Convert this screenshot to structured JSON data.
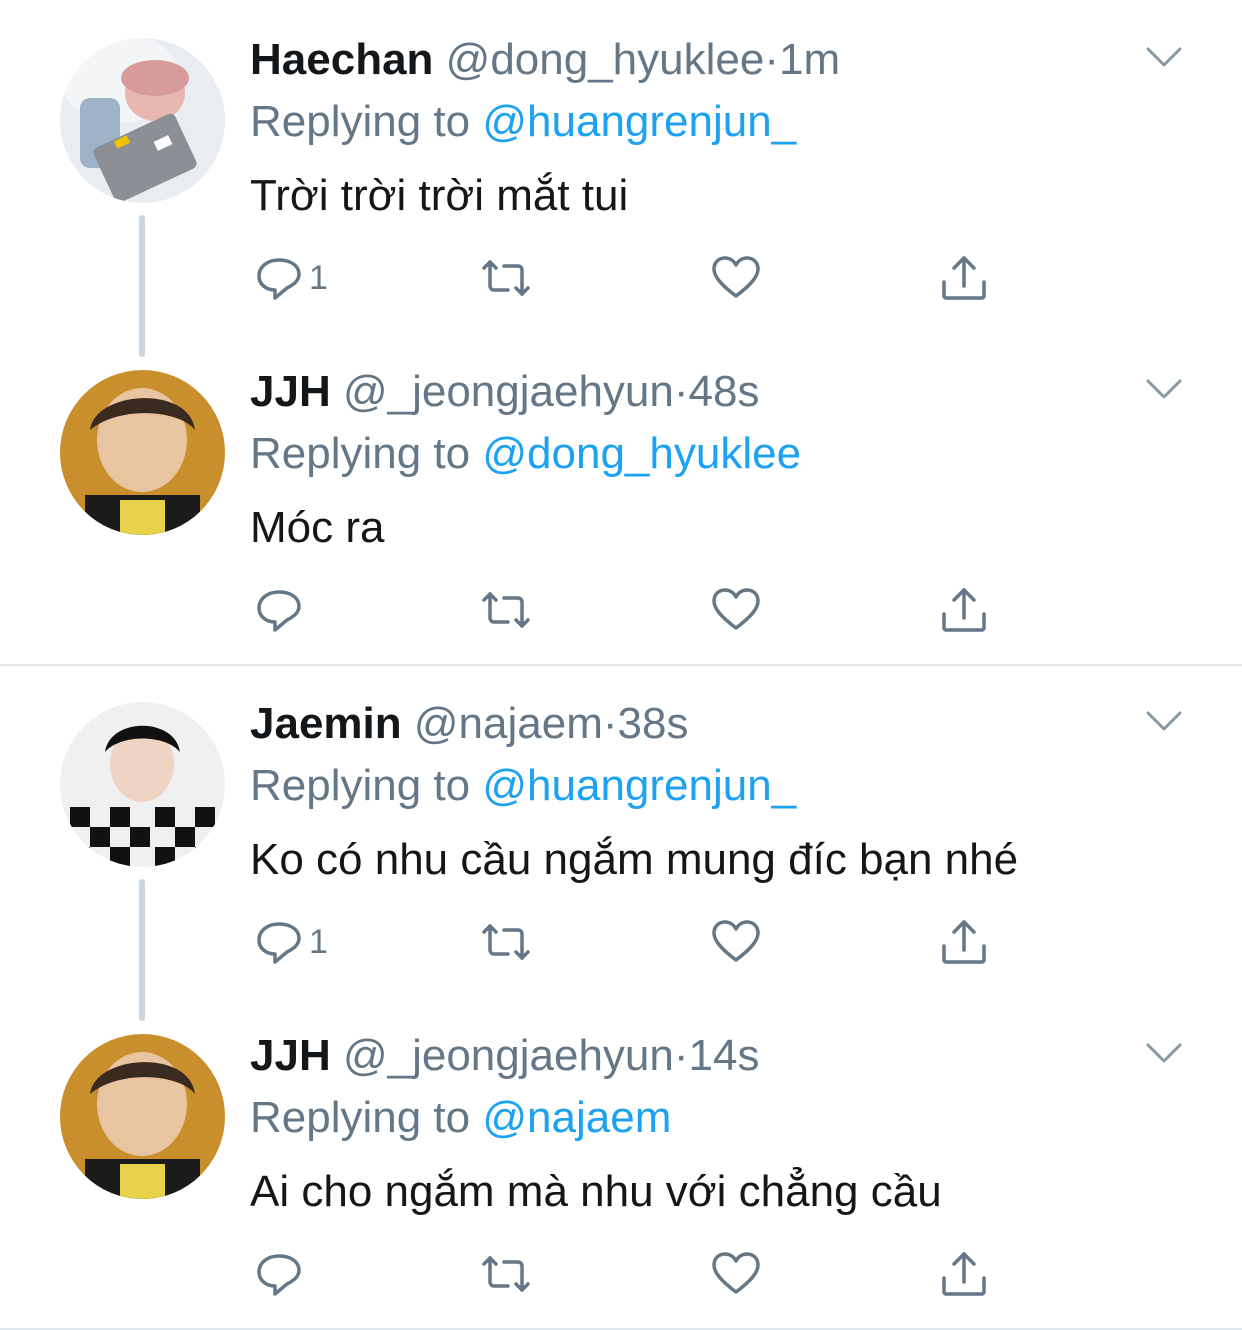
{
  "tweets": [
    {
      "name": "Haechan",
      "handle": "@dong_hyuklee",
      "dot": "·",
      "time": "1m",
      "reply_prefix": "Replying to",
      "reply_to": "@huangrenjun_",
      "text": "Trời trời trời mắt tui",
      "reply_count": "1"
    },
    {
      "name": "JJH",
      "handle": "@_jeongjaehyun",
      "dot": "·",
      "time": "48s",
      "reply_prefix": "Replying to",
      "reply_to": "@dong_hyuklee",
      "text": "Móc ra",
      "reply_count": ""
    },
    {
      "name": "Jaemin",
      "handle": "@najaem",
      "dot": "·",
      "time": "38s",
      "reply_prefix": "Replying to",
      "reply_to": "@huangrenjun_",
      "text": "Ko có nhu cầu ngắm mung đíc bạn nhé",
      "reply_count": "1"
    },
    {
      "name": "JJH",
      "handle": "@_jeongjaehyun",
      "dot": "·",
      "time": "14s",
      "reply_prefix": "Replying to",
      "reply_to": "@najaem",
      "text": "Ai cho ngắm mà nhu với chẳng cầu",
      "reply_count": ""
    }
  ],
  "icons": {
    "more": "chevron-down-icon",
    "reply": "reply-icon",
    "retweet": "retweet-icon",
    "like": "heart-icon",
    "share": "share-icon"
  },
  "colors": {
    "text": "#14171a",
    "secondary": "#657786",
    "link": "#1da1f2",
    "thread_line": "#ccd6dd",
    "divider": "#e1e8ed"
  }
}
